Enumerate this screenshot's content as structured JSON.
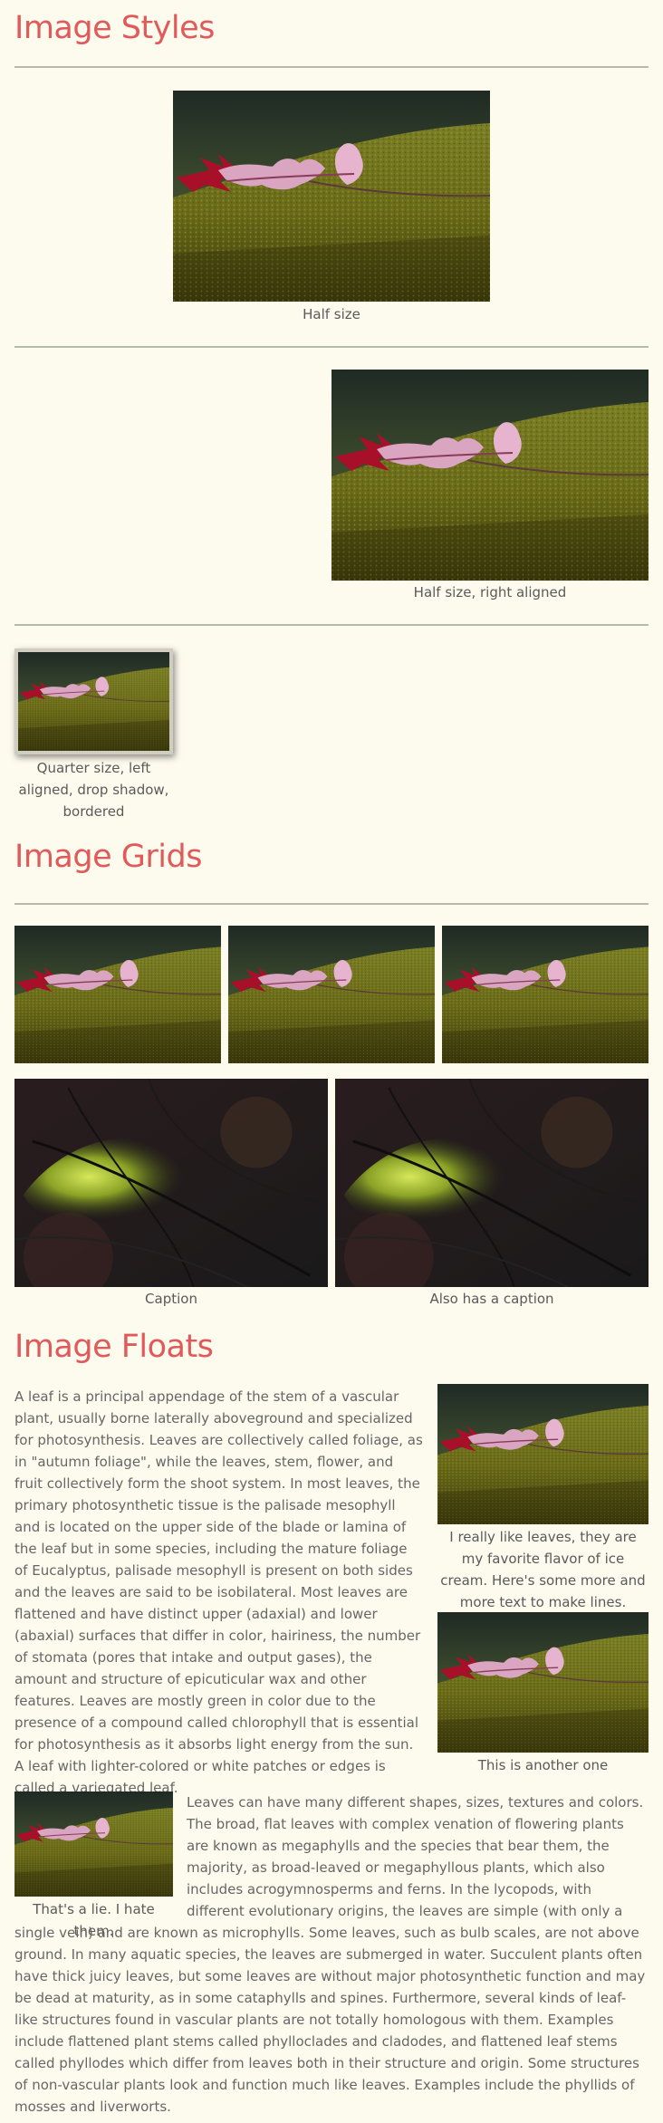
{
  "sections": {
    "styles": {
      "heading": "Image Styles"
    },
    "grids": {
      "heading": "Image Grids"
    },
    "floats": {
      "heading": "Image Floats"
    }
  },
  "styles": {
    "half_caption": "Half size",
    "right_caption": "Half size, right aligned",
    "quarter_caption": "Quarter size, left aligned, drop shadow, bordered"
  },
  "grids": {
    "caption_1": "Caption",
    "caption_2": "Also has a caption"
  },
  "floats": {
    "right_caption_1": "I really like leaves, they are my favorite flavor of ice cream. Here's some more and more text to make lines.",
    "right_caption_2": "This is another one",
    "left_caption": "That's a lie. I hate them.",
    "paragraph_1": "A leaf is a principal appendage of the stem of a vascular plant, usually borne laterally aboveground and specialized for photosynthesis. Leaves are collectively called foliage, as in \"autumn foliage\", while the leaves, stem, flower, and fruit collectively form the shoot system. In most leaves, the primary photosynthetic tissue is the palisade mesophyll and is located on the upper side of the blade or lamina of the leaf but in some species, including the mature foliage of Eucalyptus, palisade mesophyll is present on both sides and the leaves are said to be isobilateral. Most leaves are flattened and have distinct upper (adaxial) and lower (abaxial) surfaces that differ in color, hairiness, the number of stomata (pores that intake and output gases), the amount and structure of epicuticular wax and other features. Leaves are mostly green in color due to the presence of a compound called chlorophyll that is essential for photosynthesis as it absorbs light energy from the sun. A leaf with lighter-colored or white patches or edges is called a variegated leaf.",
    "paragraph_2": "Leaves can have many different shapes, sizes, textures and colors. The broad, flat leaves with complex venation of flowering plants are known as megaphylls and the species that bear them, the majority, as broad-leaved or megaphyllous plants, which also includes acrogymnosperms and ferns. In the lycopods, with different evolutionary origins, the leaves are simple (with only a single vein) and are known as microphylls. Some leaves, such as bulb scales, are not above ground. In many aquatic species, the leaves are submerged in water. Succulent plants often have thick juicy leaves, but some leaves are without major photosynthetic function and may be dead at maturity, as in some cataphylls and spines. Furthermore, several kinds of leaf-like structures found in vascular plants are not totally homologous with them. Examples include flattened plant stems called phylloclades and cladodes, and flattened leaf stems called phyllodes which differ from leaves both in their structure and origin. Some structures of non-vascular plants look and function much like leaves. Examples include the phyllids of mosses and liverworts."
  },
  "colors": {
    "background": "#fdfaee",
    "heading": "#e05a5a",
    "rule": "#b4bca6",
    "text": "#5a5a5a"
  }
}
